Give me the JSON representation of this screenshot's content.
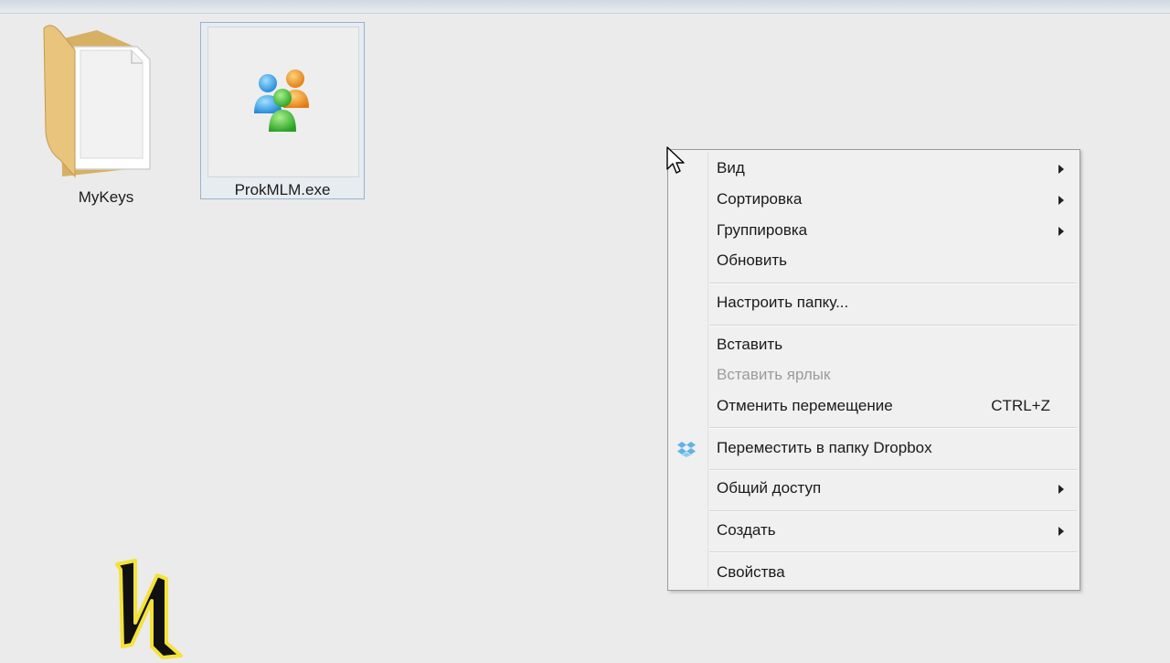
{
  "desktop": {
    "items": [
      {
        "label": "MyKeys",
        "icon": "folder-icon"
      },
      {
        "label": "ProkMLM.exe",
        "icon": "users-app-icon",
        "selected": true
      }
    ]
  },
  "context_menu": {
    "items": [
      {
        "label": "Вид",
        "submenu": true
      },
      {
        "label": "Сортировка",
        "submenu": true
      },
      {
        "label": "Группировка",
        "submenu": true
      },
      {
        "label": "Обновить"
      },
      {
        "label": "Настроить папку..."
      },
      {
        "label": "Вставить"
      },
      {
        "label": "Вставить ярлык",
        "disabled": true
      },
      {
        "label": "Отменить перемещение",
        "shortcut": "CTRL+Z"
      },
      {
        "label": "Переместить в папку Dropbox",
        "icon": "dropbox-icon"
      },
      {
        "label": "Общий доступ",
        "submenu": true
      },
      {
        "label": "Создать",
        "submenu": true
      },
      {
        "label": "Свойства"
      }
    ]
  },
  "colors": {
    "background": "#ebebeb",
    "menu_background": "#f0f0f0",
    "selection_border": "#98b3cf",
    "disabled_text": "#9b9b9b"
  }
}
